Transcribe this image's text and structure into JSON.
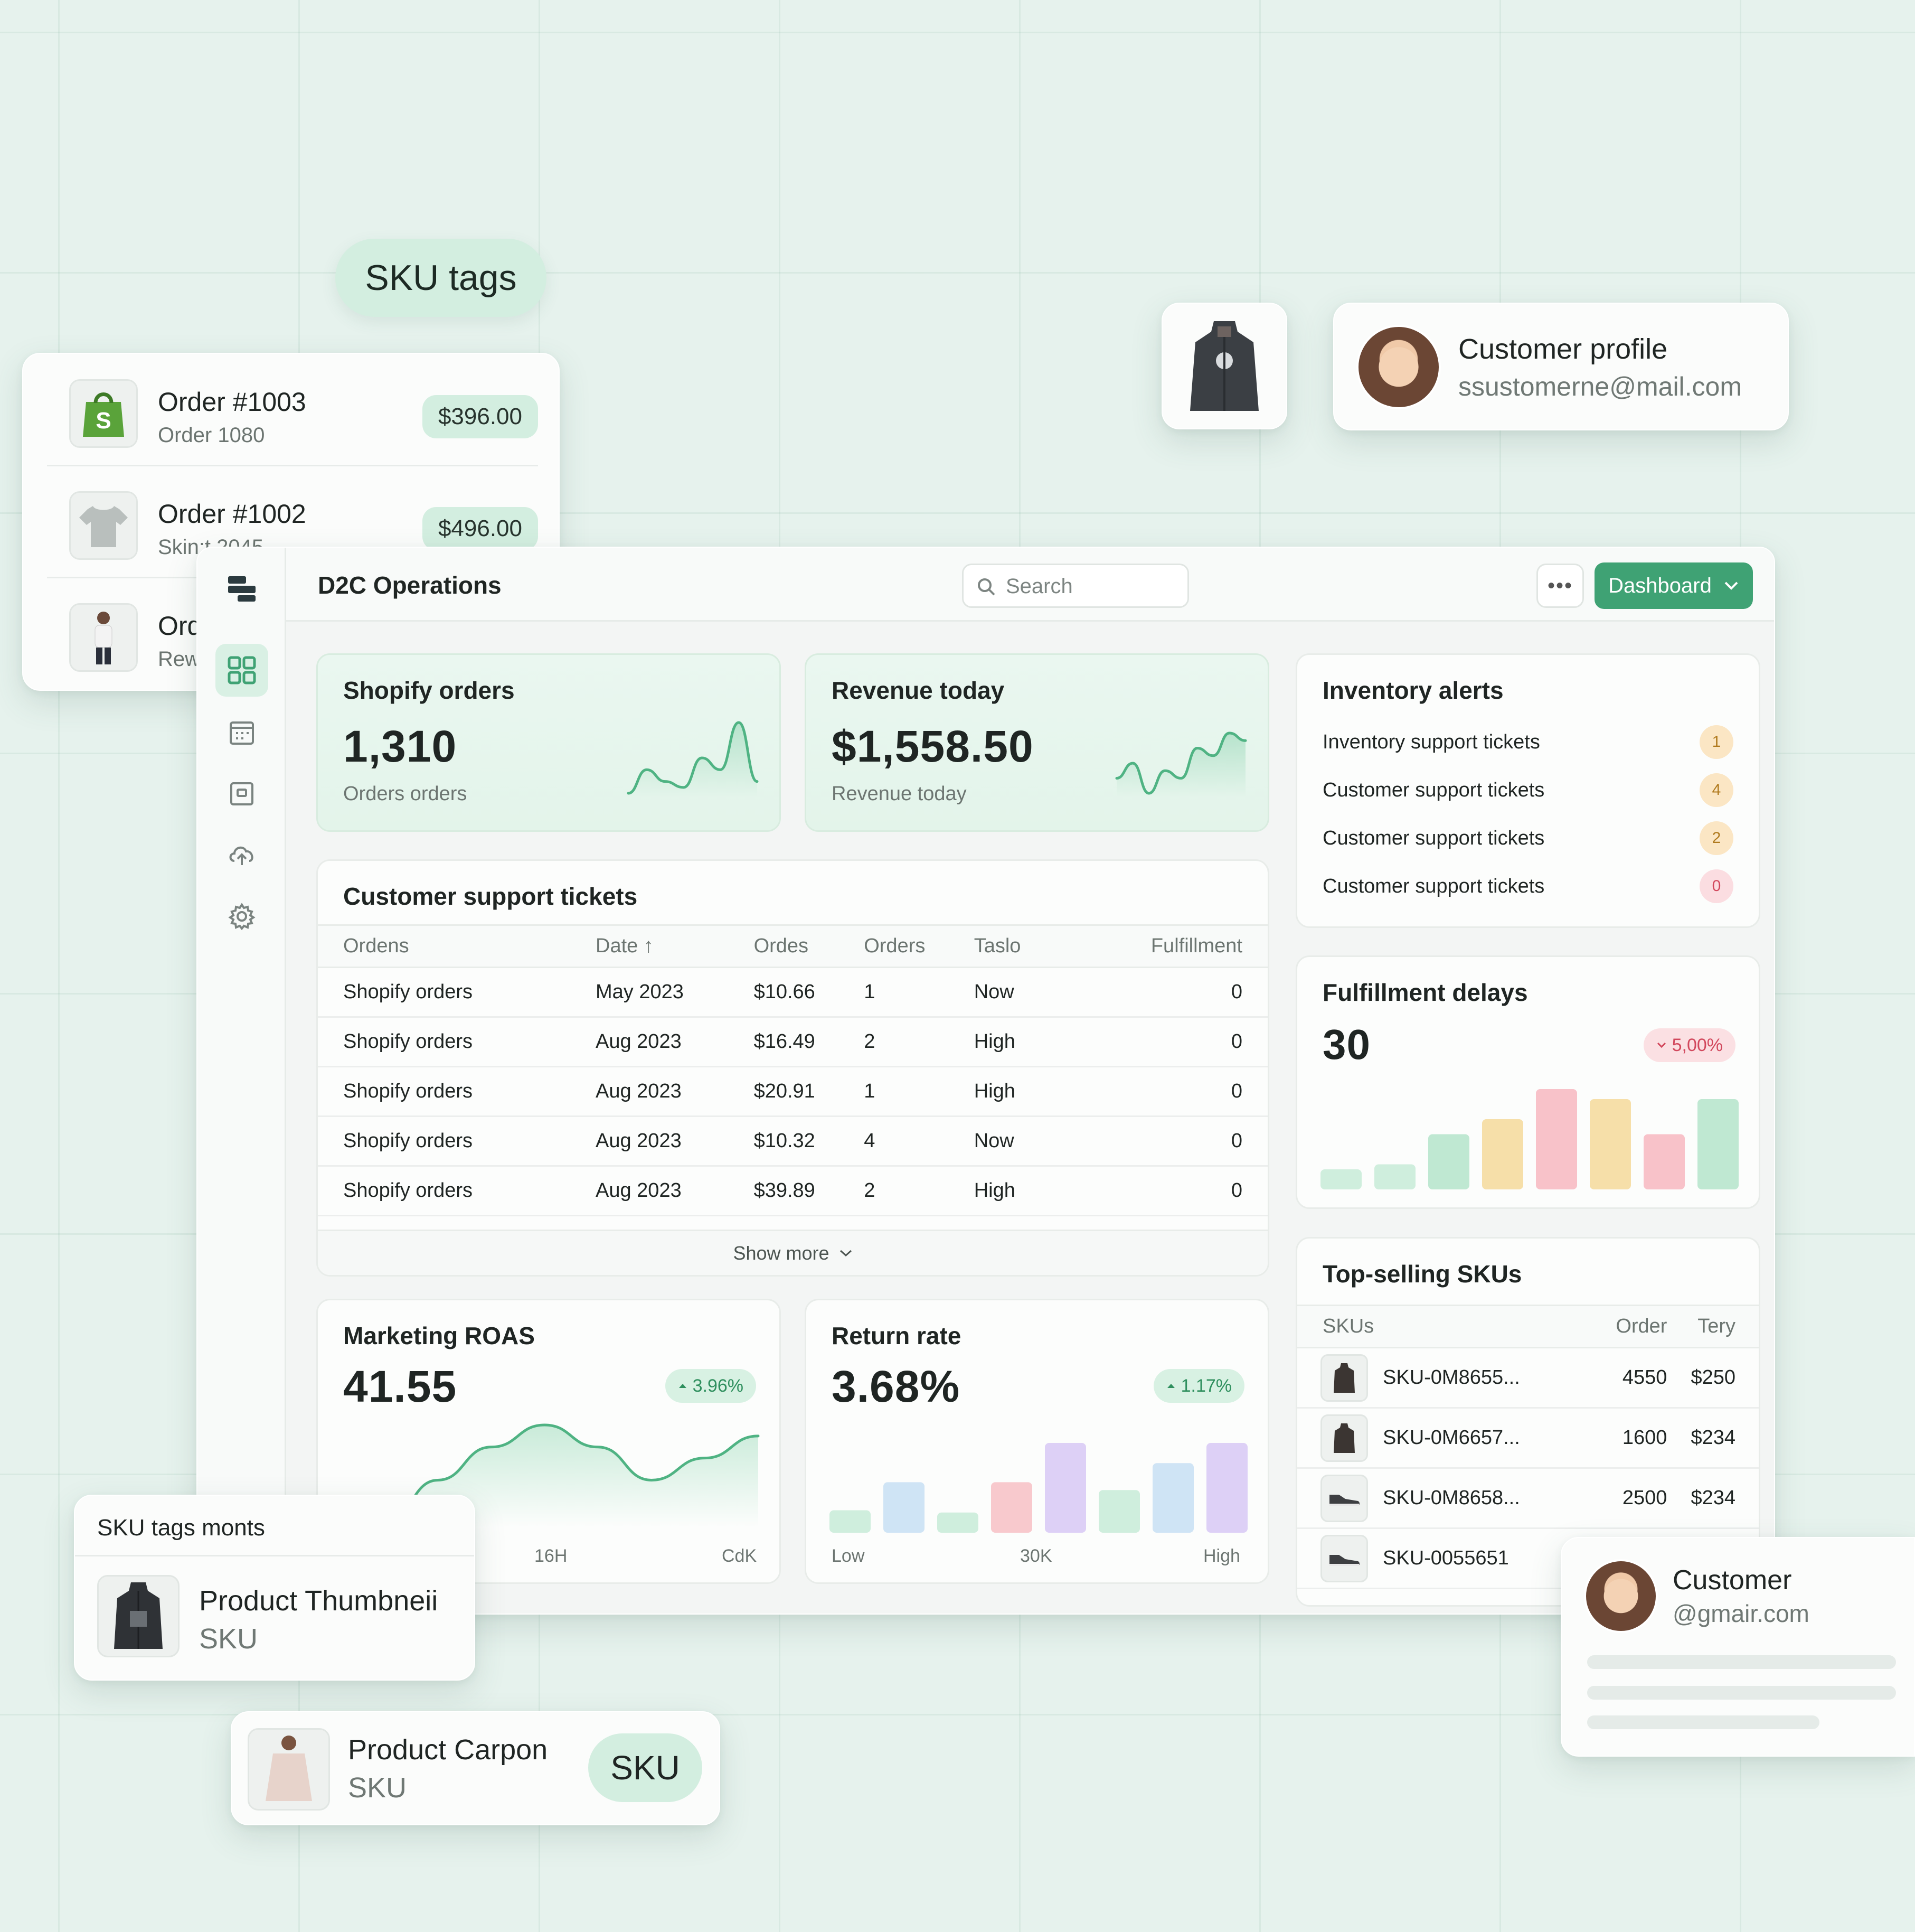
{
  "floating": {
    "sku_tags_pill": "SKU tags",
    "orders": [
      {
        "title": "Order #1003",
        "sub": "Order 1080",
        "amount": "$396.00",
        "icon": "shopping-bag-icon"
      },
      {
        "title": "Order #1002",
        "sub": "Skin:t 2045",
        "amount": "$496.00",
        "icon": "tshirt-icon"
      },
      {
        "title": "Orde",
        "sub": "Rew i",
        "amount": "",
        "icon": "person-icon"
      }
    ],
    "profile": {
      "title": "Customer profile",
      "email": "ssustomerne@mail.com"
    },
    "sku_tags_card": {
      "header": "SKU tags monts",
      "product": "Product Thumbneii",
      "sub": "SKU"
    },
    "carpon_card": {
      "product": "Product Carpon",
      "sub": "SKU",
      "tag": "SKU"
    },
    "customer_card": {
      "name": "Customer",
      "email": "@gmair.com"
    }
  },
  "app": {
    "title": "D2C Operations",
    "search_placeholder": "Search",
    "more_label": "•••",
    "dashboard_button": "Dashboard"
  },
  "kpis": {
    "shopify": {
      "title": "Shopify orders",
      "value": "1,310",
      "caption": "Orders orders"
    },
    "revenue": {
      "title": "Revenue today",
      "value": "$1,558.50",
      "caption": "Revenue today"
    }
  },
  "tickets": {
    "title": "Customer support tickets",
    "columns": [
      "Ordens",
      "Date ↑",
      "Ordes",
      "Orders",
      "Taslo",
      "Fulfillment"
    ],
    "rows": [
      [
        "Shopify orders",
        "May 2023",
        "$10.66",
        "1",
        "Now",
        "0"
      ],
      [
        "Shopify orders",
        "Aug 2023",
        "$16.49",
        "2",
        "High",
        "0"
      ],
      [
        "Shopify orders",
        "Aug 2023",
        "$20.91",
        "1",
        "High",
        "0"
      ],
      [
        "Shopify orders",
        "Aug 2023",
        "$10.32",
        "4",
        "Now",
        "0"
      ],
      [
        "Shopify orders",
        "Aug 2023",
        "$39.89",
        "2",
        "High",
        "0"
      ]
    ],
    "show_more": "Show more"
  },
  "inventory": {
    "title": "Inventory alerts",
    "items": [
      {
        "label": "Inventory support tickets",
        "count": "1",
        "color": "#fbe6c4",
        "text_color": "#b07a1e"
      },
      {
        "label": "Customer support tickets",
        "count": "4",
        "color": "#fbe6c4",
        "text_color": "#b07a1e"
      },
      {
        "label": "Customer support tickets",
        "count": "2",
        "color": "#fbe6c4",
        "text_color": "#b07a1e"
      },
      {
        "label": "Customer support tickets",
        "count": "0",
        "color": "#fbdde1",
        "text_color": "#d2485d"
      }
    ]
  },
  "fulfillment": {
    "title": "Fulfillment delays",
    "value": "30",
    "delta": "5,00%"
  },
  "roas": {
    "title": "Marketing ROAS",
    "value": "41.55",
    "delta": "3.96%",
    "x_labels": [
      "16H",
      "CdK"
    ]
  },
  "return_rate": {
    "title": "Return rate",
    "value": "3.68%",
    "delta": "1.17%",
    "x_labels": [
      "Low",
      "30K",
      "High"
    ]
  },
  "top_skus": {
    "title": "Top-selling SKUs",
    "columns": [
      "SKUs",
      "Order",
      "Tery"
    ],
    "rows": [
      {
        "sku": "SKU-0M8655...",
        "order": "4550",
        "price": "$250",
        "icon": "jacket-icon"
      },
      {
        "sku": "SKU-0M6657...",
        "order": "1600",
        "price": "$234",
        "icon": "jacket-icon"
      },
      {
        "sku": "SKU-0M8658...",
        "order": "2500",
        "price": "$234",
        "icon": "shoe-icon"
      },
      {
        "sku": "SKU-0055651",
        "order": "",
        "price": "",
        "icon": "shoe-icon"
      }
    ]
  },
  "chart_data": [
    {
      "type": "line",
      "title": "Shopify orders",
      "series": [
        {
          "values": [
            3,
            5,
            4,
            3.5,
            6,
            5,
            9,
            4
          ]
        }
      ]
    },
    {
      "type": "line",
      "title": "Revenue today",
      "series": [
        {
          "values": [
            4,
            5,
            3,
            4.5,
            4,
            6,
            5.5,
            7,
            6.5
          ]
        }
      ]
    },
    {
      "type": "bar",
      "title": "Fulfillment delays",
      "values": [
        2,
        2.5,
        5.5,
        7,
        10,
        9,
        5.5,
        9
      ],
      "colors": [
        "#cfeedd",
        "#cfeedd",
        "#bfe8d2",
        "#f6dfa9",
        "#f8c2c9",
        "#f6dfa9",
        "#f8c2c9",
        "#bfe8d2"
      ]
    },
    {
      "type": "area",
      "title": "Marketing ROAS",
      "x_ticks": [
        "16H",
        "CdK"
      ],
      "series": [
        {
          "values": [
            1,
            3,
            4.5,
            5.5,
            4.5,
            3,
            4,
            5
          ]
        }
      ]
    },
    {
      "type": "bar",
      "title": "Return rate",
      "x_ticks": [
        "Low",
        "30K",
        "High"
      ],
      "values": [
        2,
        4.5,
        1.8,
        4.5,
        8,
        3.8,
        6.2,
        8
      ],
      "colors": [
        "#cfeedd",
        "#cfe4f5",
        "#cfeedd",
        "#f8c9cd",
        "#ddd0f6",
        "#cfeedd",
        "#cfe4f5",
        "#ddd0f6"
      ]
    }
  ]
}
